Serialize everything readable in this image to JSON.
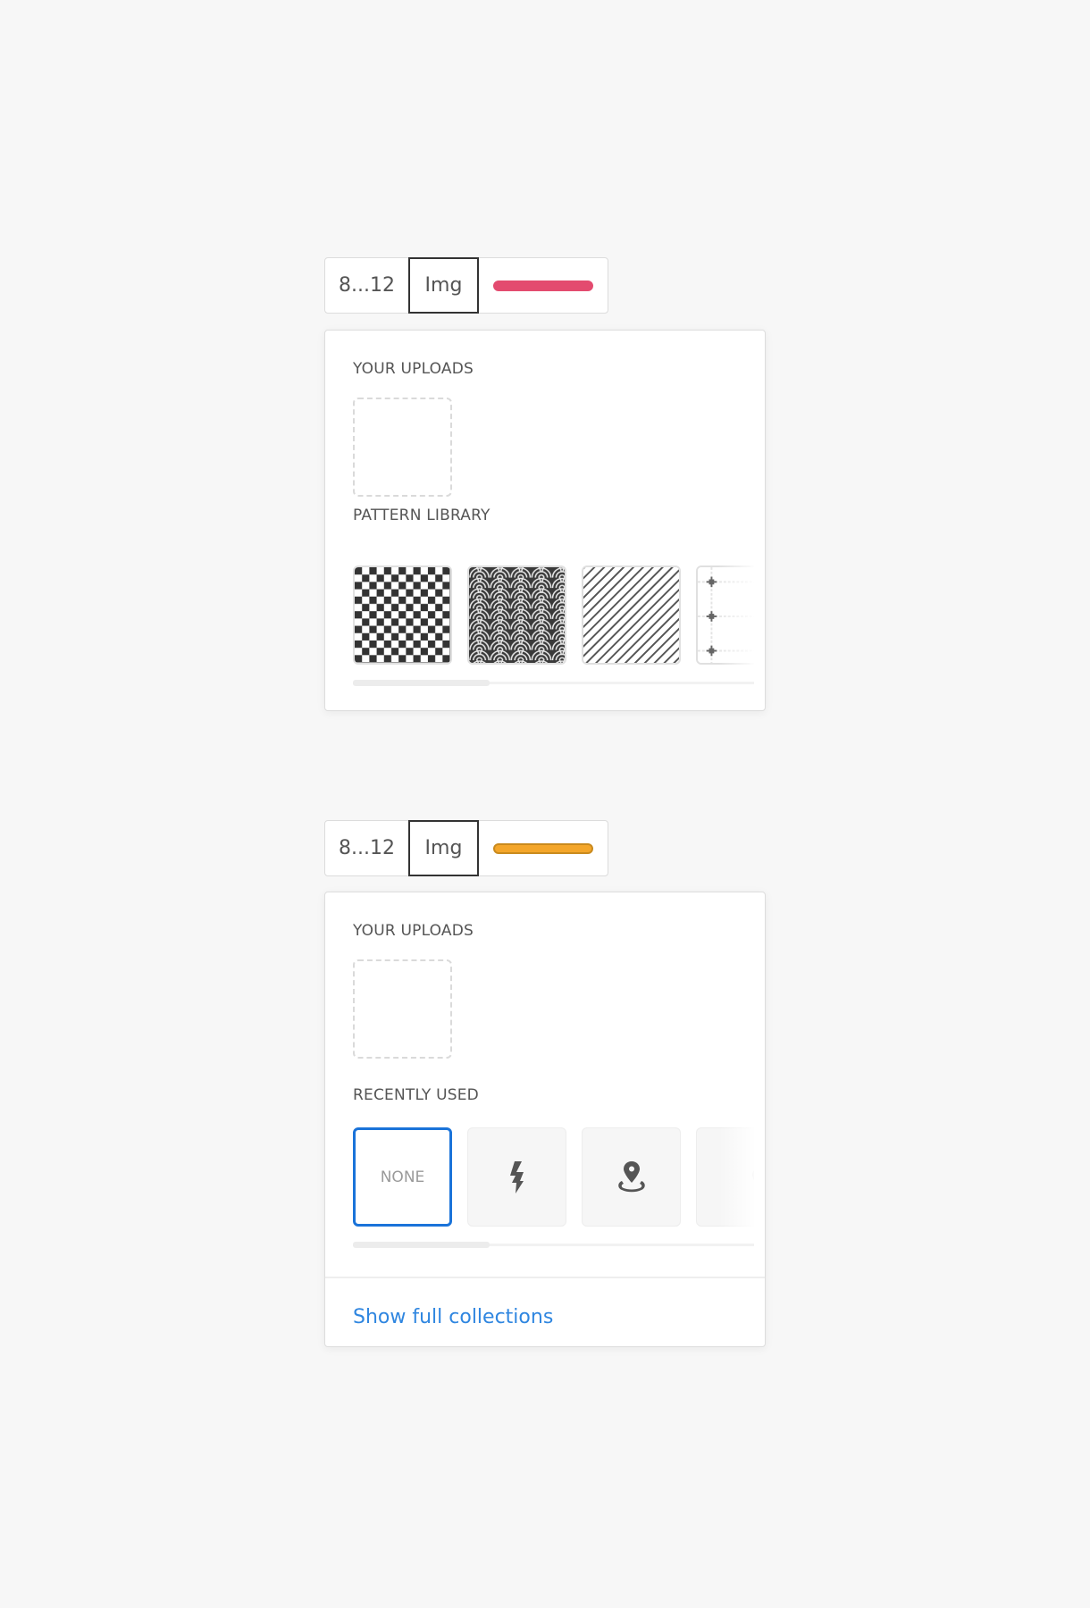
{
  "examples": [
    {
      "toolbar": {
        "size_label": "8...12",
        "img_label": "Img",
        "swatch_color": "#e34b6f",
        "swatch_border": "#e34b6f"
      },
      "panel": {
        "uploads_label": "YOUR UPLOADS",
        "library_label": "PATTERN LIBRARY",
        "patterns": [
          {
            "name": "checkerboard",
            "icon": "checker-pattern"
          },
          {
            "name": "seigaiha waves",
            "icon": "wave-pattern"
          },
          {
            "name": "diagonal stripes",
            "icon": "diagonal-stripe-pattern"
          },
          {
            "name": "plus grid",
            "icon": "plus-grid-pattern"
          }
        ],
        "scroll_fraction": 0.34
      }
    },
    {
      "toolbar": {
        "size_label": "8...12",
        "img_label": "Img",
        "swatch_color": "#f4a62a",
        "swatch_border": "#c98a1e"
      },
      "panel": {
        "uploads_label": "YOUR UPLOADS",
        "recent_label": "RECENTLY USED",
        "recent_items": [
          {
            "label": "NONE",
            "icon": "none",
            "selected": true
          },
          {
            "label": "",
            "icon": "lightning-icon",
            "selected": false
          },
          {
            "label": "",
            "icon": "map-pin-icon",
            "selected": false
          },
          {
            "label": "",
            "icon": "map-pins-icon",
            "selected": false
          }
        ],
        "scroll_fraction": 0.34,
        "footer_link": "Show full collections"
      }
    }
  ],
  "colors": {
    "accent_blue": "#1a73d9",
    "link_blue": "#2f86e0",
    "background": "#f7f7f7"
  }
}
